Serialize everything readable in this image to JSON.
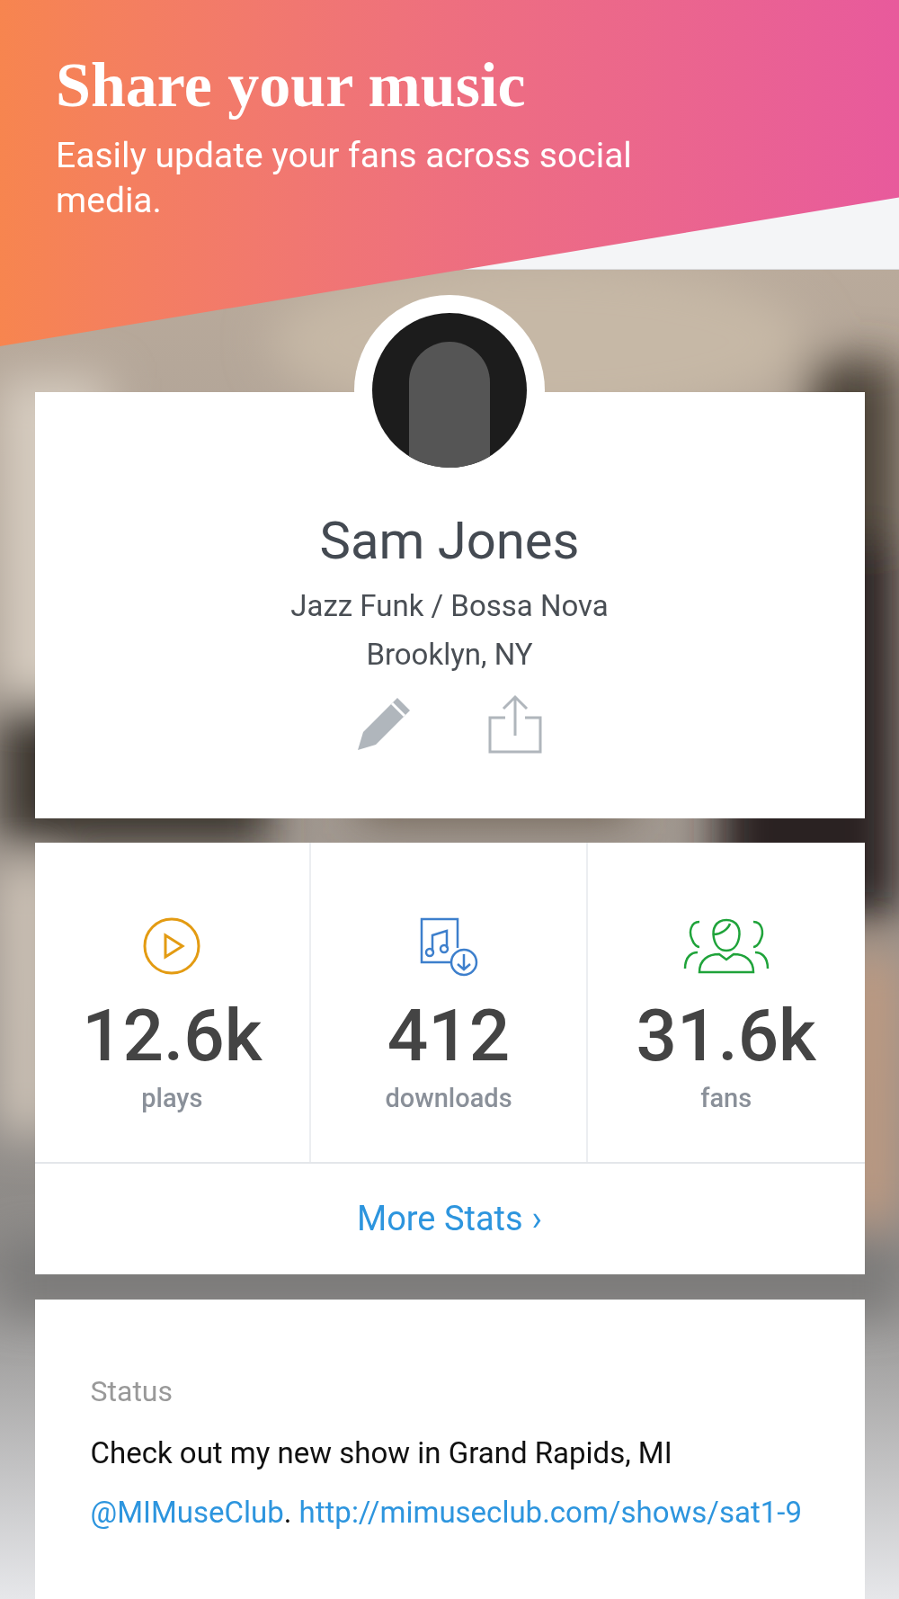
{
  "banner": {
    "title": "Share your music",
    "subtitle": "Easily update your fans across social media."
  },
  "profile": {
    "name": "Sam Jones",
    "genre": "Jazz Funk / Bossa Nova",
    "location": "Brooklyn, NY"
  },
  "stats": [
    {
      "kind": "plays",
      "value": "12.6k",
      "label": "plays",
      "color": "#e39b12"
    },
    {
      "kind": "downloads",
      "value": "412",
      "label": "downloads",
      "color": "#3d7fcc"
    },
    {
      "kind": "fans",
      "value": "31.6k",
      "label": "fans",
      "color": "#1fa33a"
    }
  ],
  "more_stats": {
    "label": "More Stats",
    "chevron": "›"
  },
  "status": {
    "label": "Status",
    "text": "Check out my new show in Grand Rapids, MI",
    "mention": "@MIMuseClub",
    "after_mention": ".",
    "url": "http://mimuseclub.com/shows/sat1-9"
  }
}
